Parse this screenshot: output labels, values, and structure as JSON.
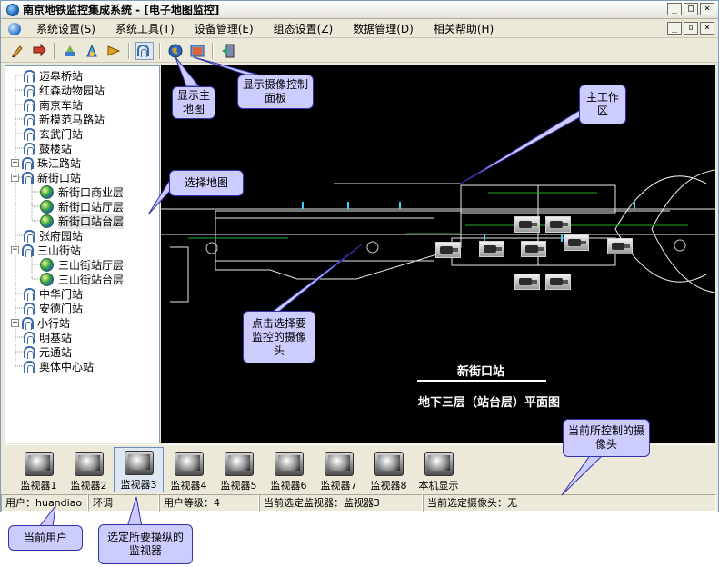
{
  "window": {
    "title": "南京地铁监控集成系统 - [电子地图监控]",
    "controls": [
      "_",
      "□",
      "×"
    ],
    "child_controls": [
      "_",
      "▫",
      "×"
    ]
  },
  "menu": [
    "系统设置(S)",
    "系统工具(T)",
    "设备管理(E)",
    "组态设置(Z)",
    "数据管理(D)",
    "相关帮助(H)"
  ],
  "toolbar": {
    "buttons": [
      "edit-icon",
      "arrow-icon",
      "tools-icon",
      "signal-icon",
      "forward-icon",
      "station-icon",
      "globe-icon",
      "camera-panel-icon",
      "exit-icon"
    ]
  },
  "tree": {
    "nodes": [
      {
        "label": "迈皋桥站"
      },
      {
        "label": "红森动物园站"
      },
      {
        "label": "南京车站"
      },
      {
        "label": "新模范马路站"
      },
      {
        "label": "玄武门站"
      },
      {
        "label": "鼓楼站"
      },
      {
        "label": "珠江路站",
        "expander": "+"
      },
      {
        "label": "新街口站",
        "expander": "−"
      },
      {
        "label": "新街口商业层"
      },
      {
        "label": "新街口站厅层"
      },
      {
        "label": "新街口站台层"
      },
      {
        "label": "张府园站"
      },
      {
        "label": "三山街站",
        "expander": "−"
      },
      {
        "label": "三山街站厅层"
      },
      {
        "label": "三山街站台层"
      },
      {
        "label": "中华门站"
      },
      {
        "label": "安德门站"
      },
      {
        "label": "小行站",
        "expander": "+"
      },
      {
        "label": "明基站"
      },
      {
        "label": "元通站"
      },
      {
        "label": "奥体中心站"
      }
    ]
  },
  "map": {
    "station_name": "新街口站",
    "floor_caption": "地下三层（站台层）平面图"
  },
  "monitors": [
    "监视器1",
    "监视器2",
    "监视器3",
    "监视器4",
    "监视器5",
    "监视器6",
    "监视器7",
    "监视器8",
    "本机显示"
  ],
  "status": {
    "user": "用户：huandiao",
    "mode": "环调",
    "level": "用户等级：4",
    "monitor": "当前选定监视器：监视器3",
    "camera": "当前选定摄像头：无"
  },
  "callouts": {
    "show_main_map": "显示主地图",
    "show_camera_panel": "显示摄像控制面板",
    "workspace": "主工作区",
    "select_map": "选择地图",
    "click_camera": "点击选择要监控的摄像头",
    "current_camera": "当前所控制的摄像头",
    "current_user": "当前用户",
    "select_monitor": "选定所要操纵的监视器"
  },
  "colors": {
    "map_bg": "#000000",
    "callout_bg": "#ccccff",
    "callout_border": "#3333aa",
    "window_bg": "#ece9d8"
  }
}
